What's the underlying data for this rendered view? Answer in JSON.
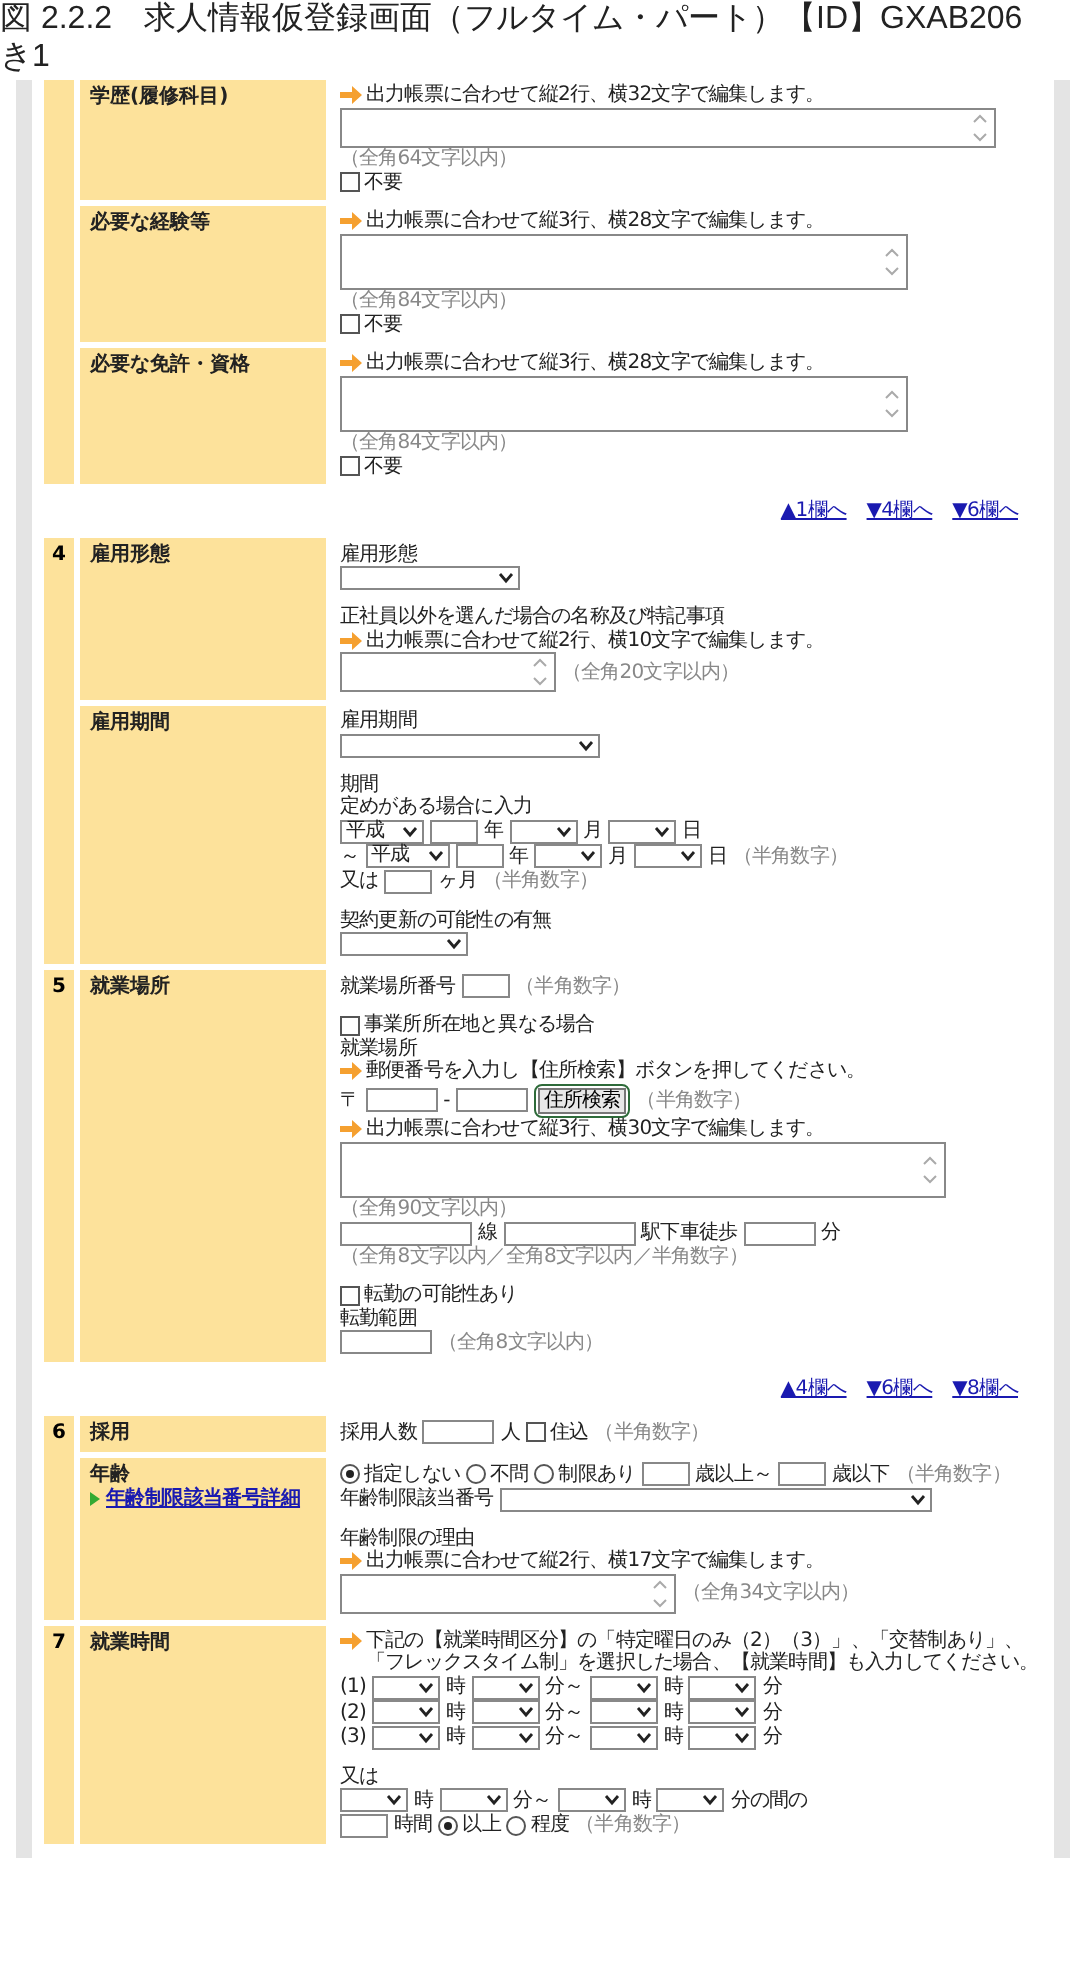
{
  "caption": [
    "図 2.2.2　求人情報仮登録画面（フルタイム・パート）【ID】GXAB206",
    "き1"
  ],
  "sections": [
    {
      "rows": [
        {
          "label": "学歴(履修科目)",
          "items": [
            {
              "kind": "hint",
              "text": "出力帳票に合わせて縦2行、横32文字で編集します。"
            },
            {
              "kind": "line-textarea"
            },
            {
              "kind": "note",
              "text": "（全角64文字以内）"
            },
            {
              "kind": "checkbox",
              "label": "不要",
              "checked": false
            }
          ]
        },
        {
          "label": "必要な経験等",
          "items": [
            {
              "kind": "hint",
              "text": "出力帳票に合わせて縦3行、横28文字で編集します。"
            },
            {
              "kind": "textarea"
            },
            {
              "kind": "note",
              "text": "（全角84文字以内）"
            },
            {
              "kind": "checkbox",
              "label": "不要",
              "checked": false
            }
          ]
        },
        {
          "label": "必要な免許・資格",
          "items": [
            {
              "kind": "hint",
              "text": "出力帳票に合わせて縦3行、横28文字で編集します。"
            },
            {
              "kind": "textarea"
            },
            {
              "kind": "note",
              "text": "（全角84文字以内）"
            },
            {
              "kind": "checkbox",
              "label": "不要",
              "checked": false
            }
          ]
        }
      ],
      "nav": [
        "▲1欄へ",
        "▼4欄へ",
        "▼6欄へ"
      ]
    },
    {
      "number": "4",
      "rows": [
        {
          "label": "雇用形態",
          "items": [
            {
              "kind": "text",
              "text": "雇用形態"
            },
            {
              "kind": "line",
              "parts": [
                {
                  "kind": "medium-select"
                }
              ]
            },
            {
              "kind": "gap"
            },
            {
              "kind": "text",
              "text": "正社員以外を選んだ場合の名称及び特記事項"
            },
            {
              "kind": "hint",
              "text": "出力帳票に合わせて縦2行、横10文字で編集します。"
            },
            {
              "kind": "line",
              "parts": [
                {
                  "kind": "small-textarea"
                },
                {
                  "kind": "note",
                  "text": "（全角20文字以内）"
                }
              ]
            }
          ]
        },
        {
          "label": "雇用期間",
          "items": [
            {
              "kind": "text",
              "text": "雇用期間"
            },
            {
              "kind": "line",
              "parts": [
                {
                  "kind": "long-select"
                }
              ]
            },
            {
              "kind": "gap"
            },
            {
              "kind": "text",
              "text": "期間"
            },
            {
              "kind": "text",
              "text": "定めがある場合に入力"
            },
            {
              "kind": "line",
              "parts": [
                {
                  "kind": "era-select",
                  "value": "平成"
                },
                {
                  "kind": "digit-input"
                },
                {
                  "kind": "text",
                  "text": "年"
                },
                {
                  "kind": "time-select"
                },
                {
                  "kind": "text",
                  "text": "月"
                },
                {
                  "kind": "time-select"
                },
                {
                  "kind": "text",
                  "text": "日"
                }
              ]
            },
            {
              "kind": "line",
              "parts": [
                {
                  "kind": "text",
                  "text": "～"
                },
                {
                  "kind": "era-select",
                  "value": "平成"
                },
                {
                  "kind": "digit-input"
                },
                {
                  "kind": "text",
                  "text": "年"
                },
                {
                  "kind": "time-select"
                },
                {
                  "kind": "text",
                  "text": "月"
                },
                {
                  "kind": "time-select"
                },
                {
                  "kind": "text",
                  "text": "日"
                },
                {
                  "kind": "note",
                  "text": "（半角数字）"
                }
              ]
            },
            {
              "kind": "line",
              "parts": [
                {
                  "kind": "text",
                  "text": "又は"
                },
                {
                  "kind": "digit-input"
                },
                {
                  "kind": "text",
                  "text": "ヶ月"
                },
                {
                  "kind": "note",
                  "text": "（半角数字）"
                }
              ]
            },
            {
              "kind": "gap"
            },
            {
              "kind": "text",
              "text": "契約更新の可能性の有無"
            },
            {
              "kind": "line",
              "parts": [
                {
                  "kind": "short-select"
                }
              ]
            }
          ]
        }
      ]
    },
    {
      "number": "5",
      "rows": [
        {
          "label": "就業場所",
          "items": [
            {
              "kind": "line",
              "parts": [
                {
                  "kind": "text",
                  "text": "就業場所番号"
                },
                {
                  "kind": "digit-input"
                },
                {
                  "kind": "note",
                  "text": "（半角数字）"
                }
              ]
            },
            {
              "kind": "gap"
            },
            {
              "kind": "checkbox",
              "label": "事業所所在地と異なる場合",
              "checked": false
            },
            {
              "kind": "text",
              "text": "就業場所"
            },
            {
              "kind": "hint",
              "text": "郵便番号を入力し【住所検索】ボタンを押してください。"
            },
            {
              "kind": "line",
              "parts": [
                {
                  "kind": "text",
                  "text": "〒"
                },
                {
                  "kind": "short-input"
                },
                {
                  "kind": "text",
                  "text": "-"
                },
                {
                  "kind": "short-input"
                },
                {
                  "kind": "button",
                  "label": "住所検索",
                  "highlighted": true
                },
                {
                  "kind": "note",
                  "text": "（半角数字）"
                }
              ]
            },
            {
              "kind": "hint",
              "text": "出力帳票に合わせて縦3行、横30文字で編集します。"
            },
            {
              "kind": "address-textarea"
            },
            {
              "kind": "note",
              "text": "（全角90文字以内）"
            },
            {
              "kind": "line",
              "parts": [
                {
                  "kind": "long-input"
                },
                {
                  "kind": "text",
                  "text": "線"
                },
                {
                  "kind": "long-input"
                },
                {
                  "kind": "text",
                  "text": "駅下車徒歩"
                },
                {
                  "kind": "short-input"
                },
                {
                  "kind": "text",
                  "text": "分"
                }
              ]
            },
            {
              "kind": "note",
              "text": "（全角8文字以内／全角8文字以内／半角数字）"
            },
            {
              "kind": "gap"
            },
            {
              "kind": "checkbox",
              "label": "転勤の可能性あり",
              "checked": false
            },
            {
              "kind": "text",
              "text": "転勤範囲"
            },
            {
              "kind": "line",
              "parts": [
                {
                  "kind": "medium-input"
                },
                {
                  "kind": "note",
                  "text": "（全角8文字以内）"
                }
              ]
            }
          ]
        }
      ],
      "nav": [
        "▲4欄へ",
        "▼6欄へ",
        "▼8欄へ"
      ]
    },
    {
      "number": "6",
      "rows": [
        {
          "label": "採用",
          "items": [
            {
              "kind": "line",
              "parts": [
                {
                  "kind": "text",
                  "text": "採用人数"
                },
                {
                  "kind": "short-input"
                },
                {
                  "kind": "text",
                  "text": "人"
                },
                {
                  "kind": "checkbox",
                  "label": "住込",
                  "checked": false
                },
                {
                  "kind": "note",
                  "text": "（半角数字）"
                }
              ]
            }
          ]
        },
        {
          "label": "年齢",
          "link": "年齢制限該当番号詳細",
          "items": [
            {
              "kind": "line",
              "parts": [
                {
                  "kind": "radio",
                  "label": "指定しない",
                  "selected": true
                },
                {
                  "kind": "radio",
                  "label": "不問",
                  "selected": false
                },
                {
                  "kind": "radio",
                  "label": "制限あり",
                  "selected": false
                },
                {
                  "kind": "digit-input"
                },
                {
                  "kind": "text",
                  "text": "歳以上～"
                },
                {
                  "kind": "digit-input"
                },
                {
                  "kind": "text",
                  "text": "歳以下"
                },
                {
                  "kind": "note",
                  "text": "（半角数字）"
                }
              ]
            },
            {
              "kind": "line",
              "parts": [
                {
                  "kind": "text",
                  "text": "年齢制限該当番号"
                },
                {
                  "kind": "wide-select"
                }
              ]
            },
            {
              "kind": "gap"
            },
            {
              "kind": "text",
              "text": "年齢制限の理由"
            },
            {
              "kind": "hint",
              "text": "出力帳票に合わせて縦2行、横17文字で編集します。"
            },
            {
              "kind": "line",
              "parts": [
                {
                  "kind": "medium-textarea"
                },
                {
                  "kind": "note",
                  "text": "（全角34文字以内）"
                }
              ]
            }
          ]
        }
      ]
    },
    {
      "number": "7",
      "rows": [
        {
          "label": "就業時間",
          "items": [
            {
              "kind": "hint",
              "text": "下記の【就業時間区分】の「特定曜日のみ（2）（3）」、「交替制あり」、「フレックスタイム制」を選択した場合、【就業時間】も入力してください。"
            },
            {
              "kind": "line",
              "parts": [
                {
                  "kind": "text",
                  "text": "(1)"
                },
                {
                  "kind": "time-select"
                },
                {
                  "kind": "text",
                  "text": "時"
                },
                {
                  "kind": "time-select"
                },
                {
                  "kind": "text",
                  "text": "分～"
                },
                {
                  "kind": "time-select"
                },
                {
                  "kind": "text",
                  "text": "時"
                },
                {
                  "kind": "time-select"
                },
                {
                  "kind": "text",
                  "text": "分"
                }
              ]
            },
            {
              "kind": "line",
              "parts": [
                {
                  "kind": "text",
                  "text": "(2)"
                },
                {
                  "kind": "time-select"
                },
                {
                  "kind": "text",
                  "text": "時"
                },
                {
                  "kind": "time-select"
                },
                {
                  "kind": "text",
                  "text": "分～"
                },
                {
                  "kind": "time-select"
                },
                {
                  "kind": "text",
                  "text": "時"
                },
                {
                  "kind": "time-select"
                },
                {
                  "kind": "text",
                  "text": "分"
                }
              ]
            },
            {
              "kind": "line",
              "parts": [
                {
                  "kind": "text",
                  "text": "(3)"
                },
                {
                  "kind": "time-select"
                },
                {
                  "kind": "text",
                  "text": "時"
                },
                {
                  "kind": "time-select"
                },
                {
                  "kind": "text",
                  "text": "分～"
                },
                {
                  "kind": "time-select"
                },
                {
                  "kind": "text",
                  "text": "時"
                },
                {
                  "kind": "time-select"
                },
                {
                  "kind": "text",
                  "text": "分"
                }
              ]
            },
            {
              "kind": "gap"
            },
            {
              "kind": "text",
              "text": "又は"
            },
            {
              "kind": "line",
              "parts": [
                {
                  "kind": "time-select"
                },
                {
                  "kind": "text",
                  "text": "時"
                },
                {
                  "kind": "time-select"
                },
                {
                  "kind": "text",
                  "text": "分～"
                },
                {
                  "kind": "time-select"
                },
                {
                  "kind": "text",
                  "text": "時"
                },
                {
                  "kind": "time-select"
                },
                {
                  "kind": "text",
                  "text": "分の間の"
                }
              ]
            },
            {
              "kind": "line",
              "parts": [
                {
                  "kind": "digit-input"
                },
                {
                  "kind": "text",
                  "text": "時間"
                },
                {
                  "kind": "radio",
                  "label": "以上",
                  "selected": true
                },
                {
                  "kind": "radio",
                  "label": "程度",
                  "selected": false
                },
                {
                  "kind": "note",
                  "text": "（半角数字）"
                }
              ]
            }
          ]
        }
      ]
    }
  ]
}
